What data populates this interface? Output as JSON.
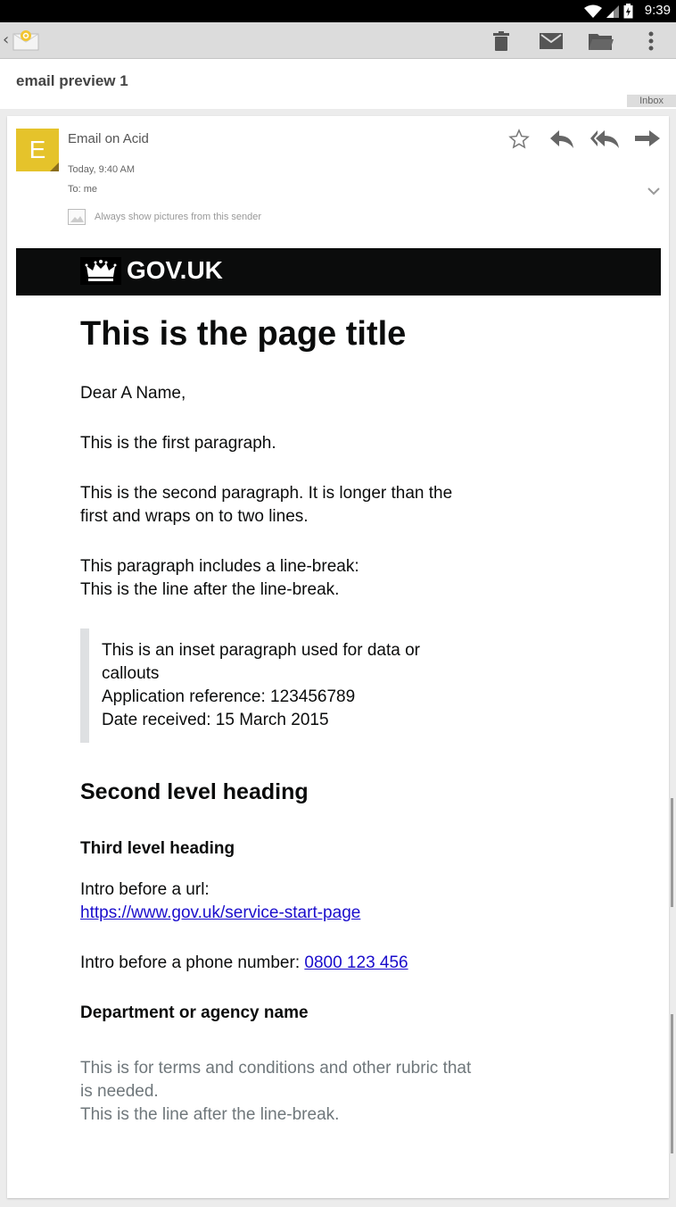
{
  "status_bar": {
    "time": "9:39",
    "icons": [
      "wifi-icon",
      "signal-icon",
      "battery-icon"
    ]
  },
  "toolbar": {
    "app_icon": "email-app-icon",
    "buttons": [
      "delete-icon",
      "mark-unread-icon",
      "move-to-folder-icon",
      "overflow-menu-icon"
    ]
  },
  "subject": "email preview 1",
  "label": "Inbox",
  "message": {
    "avatar_letter": "E",
    "sender": "Email on Acid",
    "date": "Today, 9:40 AM",
    "to": "To: me",
    "show_pictures": "Always show pictures from this sender",
    "actions": [
      "star-icon",
      "reply-icon",
      "reply-all-icon",
      "forward-icon"
    ]
  },
  "email": {
    "brand": "GOV.UK",
    "title": "This is the page title",
    "greeting": "Dear A Name,",
    "para1": "This is the first paragraph.",
    "para2": "This is the second paragraph. It is longer than the first and wraps on to two lines.",
    "para3_line1": "This paragraph includes a line-break:",
    "para3_line2": "This is the line after the line-break.",
    "inset_line1": "This is an inset paragraph used for data or callouts",
    "inset_line2": "Application reference: 123456789",
    "inset_line3": "Date received: 15 March 2015",
    "h2": "Second level heading",
    "h3": "Third level heading",
    "url_intro": "Intro before a url:",
    "url": "https://www.gov.uk/service-start-page",
    "phone_intro": "Intro before a phone number: ",
    "phone": "0800 123 456",
    "dept": "Department or agency name",
    "rubric_line1": "This is for terms and conditions and other rubric that is needed.",
    "rubric_line2": "This is the line after the line-break."
  },
  "colors": {
    "avatar": "#e5c32b",
    "govbar": "#0b0c0c",
    "link": "#1a0dcc",
    "rubric": "#6f777b"
  }
}
